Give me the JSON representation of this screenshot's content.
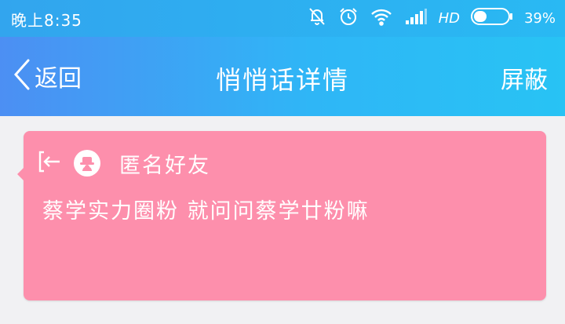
{
  "status_bar": {
    "time": "晚上8:35",
    "network": "HD",
    "battery": "39%",
    "battery_level": 0.39,
    "icons": [
      "mute-bell-icon",
      "alarm-clock-icon",
      "wifi-icon",
      "signal-icon",
      "battery-icon"
    ]
  },
  "nav": {
    "back_label": "返回",
    "title": "悄悄话详情",
    "action_label": "屏蔽"
  },
  "card": {
    "background": "#fd8fac",
    "sender": "匿名好友",
    "message": "蔡学实力圈粉 就问问蔡学廿粉嘛",
    "icons": [
      "exit-icon",
      "anonymous-avatar-icon"
    ]
  }
}
